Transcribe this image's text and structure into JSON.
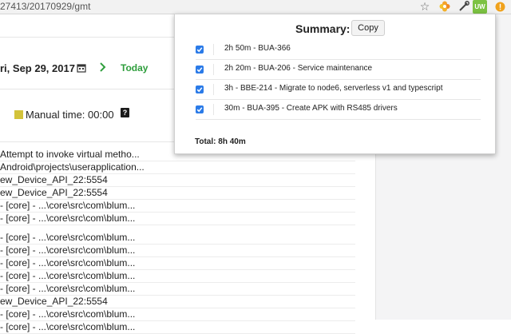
{
  "browser": {
    "url": "27413/20170929/gmt",
    "extension_badge": "UW"
  },
  "page": {
    "date": "ri, Sep 29, 2017",
    "today_label": "Today",
    "manual_time": "Manual time: 00:00",
    "help_symbol": "?",
    "log_lines": [
      "Attempt to invoke virtual metho...",
      "Android\\projects\\userapplication...",
      "ew_Device_API_22:5554",
      "ew_Device_API_22:5554",
      "- [core] - ...\\core\\src\\com\\blum...",
      "- [core] - ...\\core\\src\\com\\blum...",
      "- [core] - ...\\core\\src\\com\\blum...",
      "- [core] - ...\\core\\src\\com\\blum...",
      "- [core] - ...\\core\\src\\com\\blum...",
      "- [core] - ...\\core\\src\\com\\blum...",
      "- [core] - ...\\core\\src\\com\\blum...",
      "ew_Device_API_22:5554",
      "- [core] - ...\\core\\src\\com\\blum...",
      "- [core] - ...\\core\\src\\com\\blum..."
    ]
  },
  "summary": {
    "title": "Summary:",
    "copy_label": "Copy",
    "entries": [
      {
        "text": "2h 50m - BUA-366",
        "checked": true
      },
      {
        "text": "2h 20m - BUA-206 - Service maintenance",
        "checked": true
      },
      {
        "text": "3h - BBE-214 - Migrate to node6, serverless v1 and typescript",
        "checked": true
      },
      {
        "text": "30m - BUA-395 - Create APK with RS485 drivers",
        "checked": true
      }
    ],
    "total": "Total: 8h 40m"
  },
  "colors": {
    "accent_green": "#2e9e3c",
    "checkbox_blue": "#2b7be8",
    "manual_swatch": "#d3c33a",
    "extension_green": "#7cc242"
  }
}
